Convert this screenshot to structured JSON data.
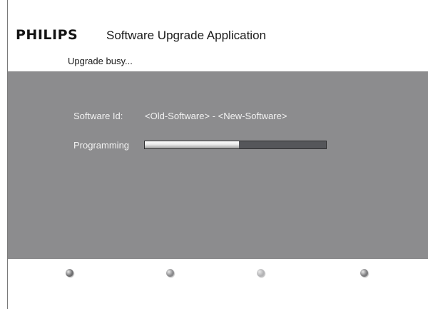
{
  "header": {
    "brand": "PHILIPS",
    "title": "Software Upgrade Application",
    "status": "Upgrade busy..."
  },
  "panel": {
    "software_id_label": "Software Id:",
    "software_id_value": "<Old-Software> - <New-Software>",
    "programming_label": "Programming",
    "progress_fraction": 0.52
  },
  "footer": {
    "color_keys": [
      {
        "icon": "red-key-icon",
        "color": "#6e6e70"
      },
      {
        "icon": "green-key-icon",
        "color": "#8a8a8c"
      },
      {
        "icon": "yellow-key-icon",
        "color": "#b4b4b6"
      },
      {
        "icon": "blue-key-icon",
        "color": "#7c7c7e"
      }
    ]
  },
  "colors": {
    "panel_background": "#8c8c8e",
    "progress_track": "#55565a"
  }
}
